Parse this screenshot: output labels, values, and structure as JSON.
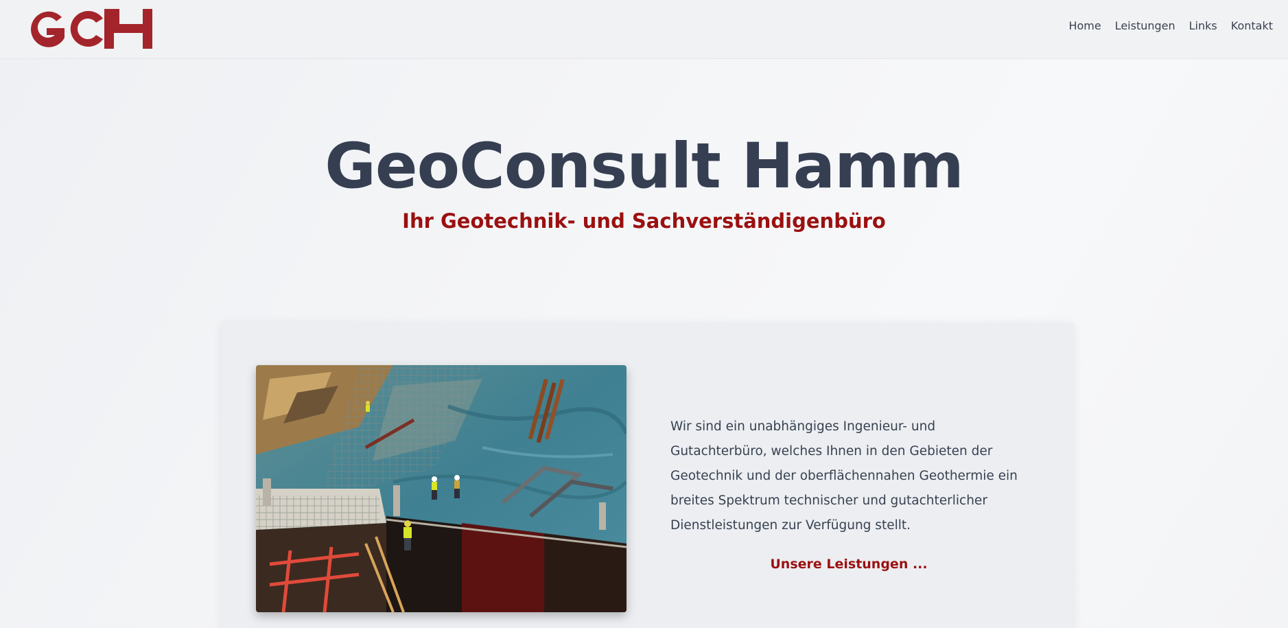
{
  "header": {
    "logo_text": "GCH",
    "nav": [
      {
        "label": "Home"
      },
      {
        "label": "Leistungen"
      },
      {
        "label": "Links"
      },
      {
        "label": "Kontakt"
      }
    ]
  },
  "hero": {
    "title": "GeoConsult Hamm",
    "subtitle": "Ihr Geotechnik- und Sachverständigenbüro"
  },
  "intro": {
    "text": "Wir sind ein unabhängiges Ingenieur- und Gutachterbüro, welches Ihnen in den Gebieten der Geotechnik und der oberflächennahen Geothermie ein breites Spektrum technischer und gutachterlicher Dienstleistungen zur Verfügung stellt.",
    "cta_label": "Unsere Leistungen ..."
  },
  "colors": {
    "brand_red": "#9b1010",
    "title_slate": "#363f52"
  },
  "icons": {
    "logo": "gch-logo",
    "photo": "construction-site-photo"
  }
}
